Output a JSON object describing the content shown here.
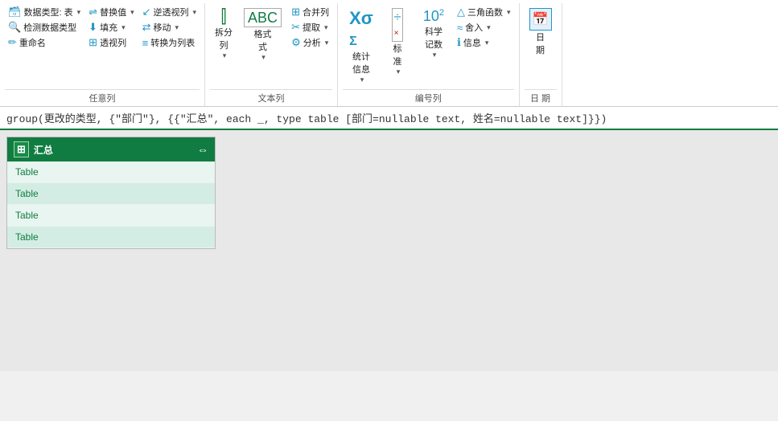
{
  "ribbon": {
    "groups": [
      {
        "id": "arbitrary-col",
        "title": "任意列",
        "rows": [
          [
            {
              "type": "small",
              "label": "数据类型: 表",
              "icon": "🗃",
              "dropdown": true
            },
            {
              "type": "small",
              "label": "替换值",
              "icon": "⇌",
              "dropdown": true
            },
            {
              "type": "small",
              "label": "逆透视列",
              "icon": "↙",
              "dropdown": true
            }
          ],
          [
            {
              "type": "small",
              "label": "检测数据类型",
              "icon": "🔍",
              "dropdown": false
            },
            {
              "type": "small",
              "label": "填充",
              "icon": "⬇",
              "dropdown": true
            },
            {
              "type": "small",
              "label": "移动",
              "icon": "⇄",
              "dropdown": true
            }
          ],
          [
            {
              "type": "small",
              "label": "重命名",
              "icon": "✏",
              "dropdown": false
            },
            {
              "type": "small",
              "label": "透视列",
              "icon": "⊞",
              "dropdown": false
            },
            {
              "type": "small",
              "label": "转换为列表",
              "icon": "≡",
              "dropdown": false
            }
          ]
        ]
      },
      {
        "id": "text-col",
        "title": "文本列",
        "large_buttons": [
          {
            "label": "拆分\n列",
            "icon": "⫿"
          },
          {
            "label": "格式\n式",
            "icon": "ABC"
          }
        ],
        "rows": [
          [
            {
              "type": "small",
              "label": "合并列",
              "icon": "⊞",
              "dropdown": false
            },
            {
              "type": "small",
              "label": "提取",
              "icon": "✂",
              "dropdown": true
            }
          ],
          [
            {
              "type": "small",
              "label": "分析",
              "icon": "⚙",
              "dropdown": true
            }
          ]
        ]
      },
      {
        "id": "number-col",
        "title": "编号列",
        "large_buttons": [
          {
            "label": "统计\n信息",
            "icon": "Σ"
          },
          {
            "label": "标\n准",
            "icon": "÷"
          },
          {
            "label": "科学\n记数",
            "icon": "10²"
          }
        ],
        "rows": [
          [
            {
              "type": "small",
              "label": "三角函数",
              "icon": "△",
              "dropdown": true
            }
          ],
          [
            {
              "type": "small",
              "label": "舍入",
              "icon": "≈",
              "dropdown": false
            }
          ],
          [
            {
              "type": "small",
              "label": "信息",
              "icon": "ℹ",
              "dropdown": true
            }
          ]
        ]
      },
      {
        "id": "date-col",
        "title": "日\n期",
        "large_buttons": [
          {
            "label": "日\n期",
            "icon": "📅"
          }
        ]
      }
    ]
  },
  "formula_bar": {
    "text": "group(更改的类型, {\"部门\"}, {{\"汇总\", each _, type table [部门=nullable text, 姓名=nullable text]}})"
  },
  "table_panel": {
    "header_label": "汇总",
    "expand_icon": "⇔",
    "rows": [
      {
        "label": "Table"
      },
      {
        "label": "Table"
      },
      {
        "label": "Table"
      },
      {
        "label": "Table"
      }
    ]
  }
}
